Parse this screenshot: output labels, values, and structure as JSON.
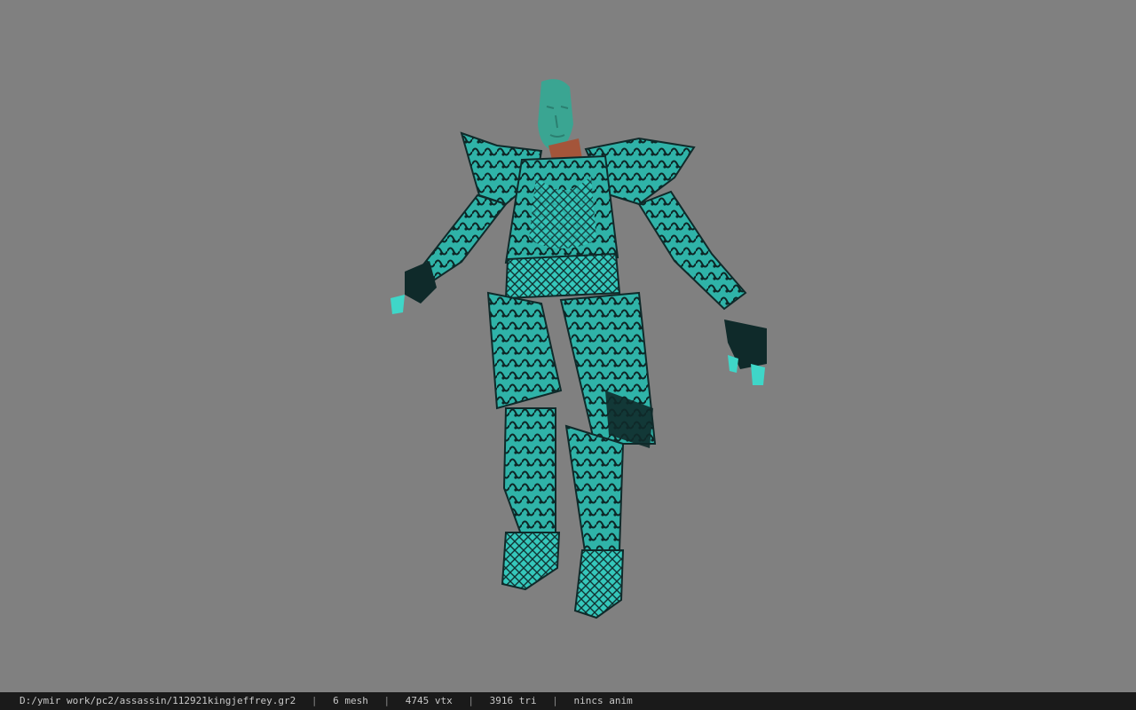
{
  "viewport": {
    "background_color": "#808080",
    "model": {
      "icon": "armored-character-model",
      "armor_color": "#3fd6c8",
      "armor_dark_color": "#0f2a2a",
      "skin_color": "#3aa592",
      "neck_color": "#a4553a"
    }
  },
  "statusbar": {
    "file_path": "D:/ymir work/pc2/assassin/112921kingjeffrey.gr2",
    "separator": "|",
    "mesh_count": "6 mesh",
    "vertex_count": "4745 vtx",
    "triangle_count": "3916 tri",
    "animation": "nincs anim"
  }
}
